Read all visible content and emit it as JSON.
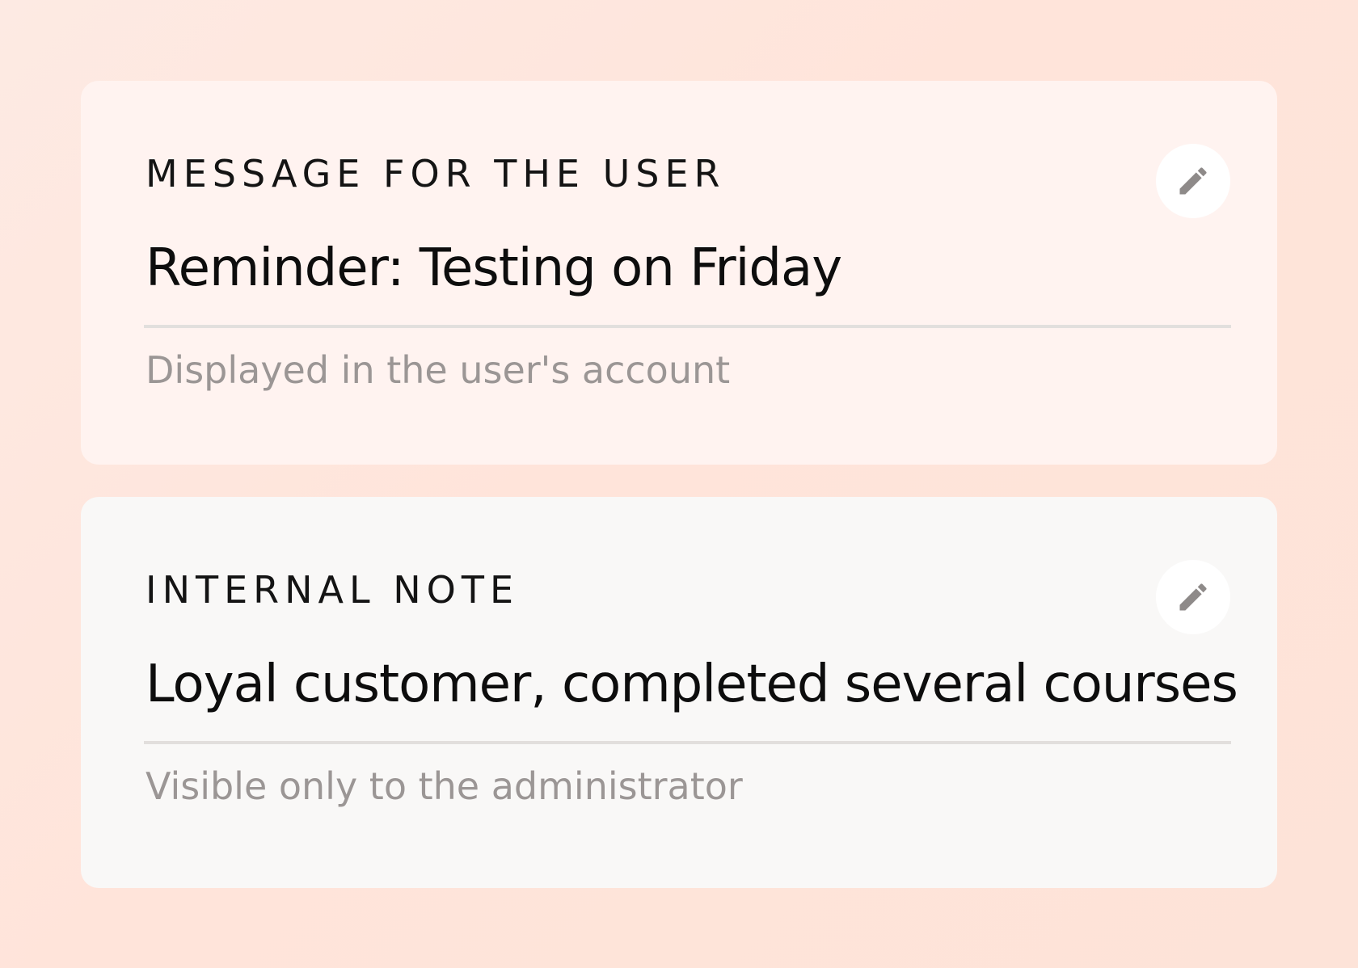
{
  "cards": [
    {
      "label": "MESSAGE FOR THE USER",
      "value": "Reminder: Testing on Friday",
      "hint": "Displayed in the user's account",
      "edit_icon": "pencil-icon"
    },
    {
      "label": "INTERNAL NOTE",
      "value": "Loyal customer, completed several courses",
      "hint": "Visible only to the administrator",
      "edit_icon": "pencil-icon"
    }
  ],
  "colors": {
    "icon": "#8e8a89",
    "hint_text": "#9b9695",
    "divider": "#e2dfdd"
  }
}
